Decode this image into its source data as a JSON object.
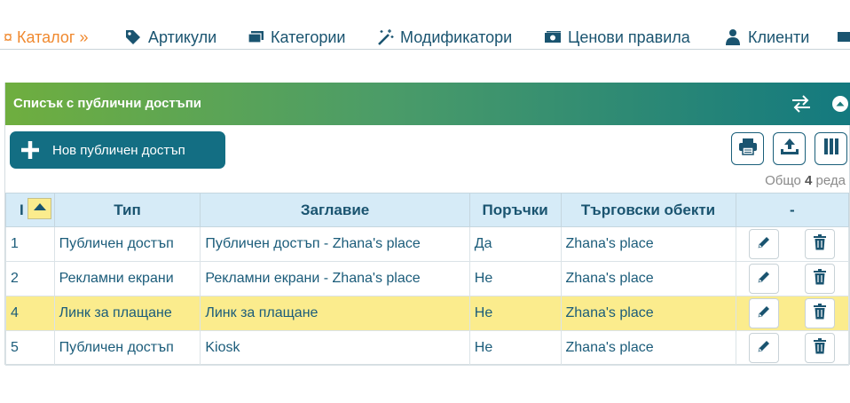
{
  "nav": {
    "current": "¤ Каталог »",
    "items": [
      {
        "label": "Артикули",
        "icon": "tag-icon"
      },
      {
        "label": "Категории",
        "icon": "folders-icon"
      },
      {
        "label": "Модификатори",
        "icon": "magic-wand-icon"
      },
      {
        "label": "Ценови правила",
        "icon": "money-icon"
      },
      {
        "label": "Клиенти",
        "icon": "user-icon"
      }
    ]
  },
  "panel": {
    "title": "Списък с публични достъпи",
    "new_button": "Нов публичен достъп",
    "total_prefix": "Общо",
    "total_count": "4",
    "total_suffix": "реда"
  },
  "table": {
    "columns": [
      "I",
      "Тип",
      "Заглавие",
      "Поръчки",
      "Търговски обекти",
      "-"
    ],
    "rows": [
      {
        "id": "1",
        "type": "Публичен достъп",
        "title": "Публичен достъп - Zhana's place",
        "orders": "Да",
        "objects": "Zhana's place"
      },
      {
        "id": "2",
        "type": "Рекламни екрани",
        "title": "Рекламни екрани - Zhana's place",
        "orders": "Не",
        "objects": "Zhana's place"
      },
      {
        "id": "4",
        "type": "Линк за плащане",
        "title": "Линк за плащане",
        "orders": "Не",
        "objects": "Zhana's place"
      },
      {
        "id": "5",
        "type": "Публичен достъп",
        "title": "Kiosk",
        "orders": "Не",
        "objects": "Zhana's place"
      }
    ],
    "highlighted_row": 2
  },
  "colors": {
    "accent": "#136e83",
    "highlight": "#fbec8d",
    "header_bg": "#d6ebf7",
    "nav_current": "#f0892f"
  }
}
